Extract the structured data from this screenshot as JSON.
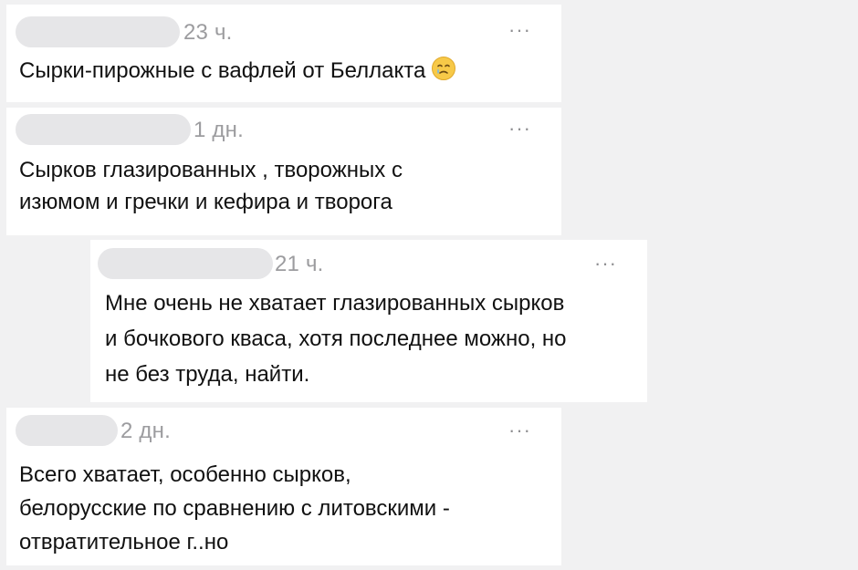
{
  "comments": [
    {
      "time": "23 ч.",
      "more": "···",
      "text": "Сырки-пирожные с вафлей от Беллакта",
      "emoji": "face-holding-back-tears-icon"
    },
    {
      "time": "1 дн.",
      "more": "···",
      "text": "Сырков глазированных , творожных с\nизюмом и гречки и кефира и творога"
    },
    {
      "time": "21 ч.",
      "more": "···",
      "text": "Мне очень не хватает глазированных сырков\nи бочкового кваса, хотя последнее можно, но\nне без труда, найти."
    },
    {
      "time": "2 дн.",
      "more": "···",
      "text": "Всего хватает, особенно сырков,\nбелорусские по сравнению с литовскими -\nотвратительное г..но"
    }
  ]
}
